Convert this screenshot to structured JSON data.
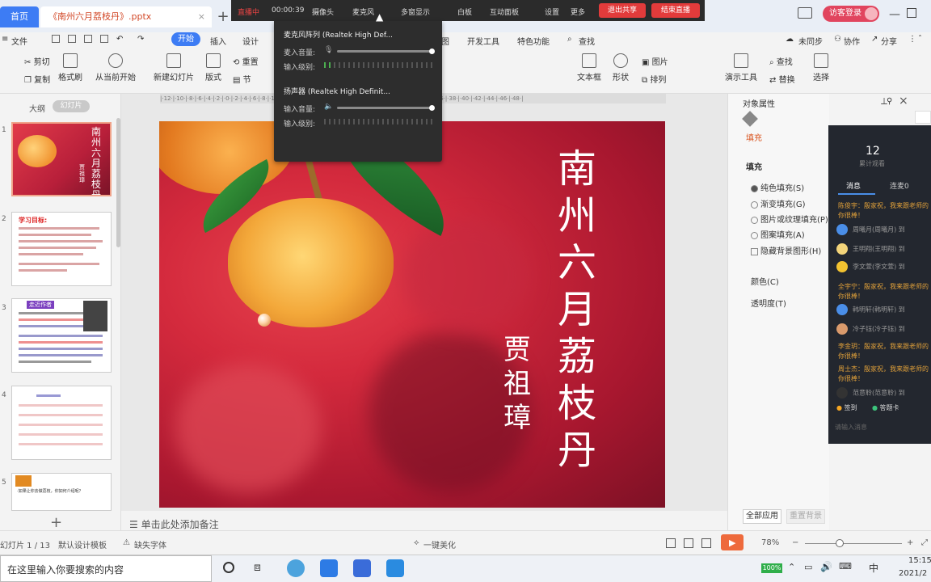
{
  "titlebar": {
    "home_tab": "首页",
    "doc_tab": "《南州六月荔枝丹》.pptx",
    "new_tab": "+",
    "login_label": "访客登录"
  },
  "recording_bar": {
    "status": "直播中",
    "timer": "00:00:39",
    "items": [
      "摄像头",
      "麦克风",
      "多窗显示",
      "白板",
      "互动面板",
      "设置",
      "更多"
    ],
    "stop_label": "退出共享",
    "end_label": "结束直播"
  },
  "popup": {
    "mic_device": "麦克风阵列 (Realtek High Def...",
    "mic_volume_label": "麦入音量:",
    "mic_level_label": "输入级别:",
    "speaker_device": "扬声器 (Realtek High Definit...",
    "speaker_volume_label": "输入音量:",
    "speaker_level_label": "输入级别:"
  },
  "menubar": {
    "file": "文件",
    "start": "开始",
    "insert": "插入",
    "design": "设计",
    "animation": "图",
    "dev": "开发工具",
    "special": "特色功能",
    "search": "查找",
    "cloud": "未同步",
    "collab": "协作",
    "share": "分享"
  },
  "ribbon": {
    "cut": "剪切",
    "copy": "复制",
    "format_painter": "格式刷",
    "from_start": "从当前开始",
    "new_slide": "新建幻灯片",
    "layout": "版式",
    "reset": "重置",
    "section": "节",
    "textbox": "文本框",
    "shape": "形状",
    "arrange": "排列",
    "image": "图片",
    "find": "查找",
    "replace": "替换",
    "present_tools": "演示工具",
    "select": "选择"
  },
  "left_panel": {
    "outline_tab": "大纲",
    "slides_tab": "幻灯片",
    "thumb1_title": "南州六月荔枝丹",
    "thumb1_author": "贾祖璋",
    "thumb2_heading": "学习目标:",
    "thumb3_badge": "走近作者",
    "thumb5_text": "·如果让你去做荔枝，你如何介绍呢？",
    "slide_numbers": [
      "1",
      "2",
      "3",
      "4",
      "5"
    ]
  },
  "slide": {
    "title": "南州六月荔枝丹",
    "author": "贾祖璋"
  },
  "notes": "单击此处添加备注",
  "properties": {
    "header": "对象属性",
    "fill_tab": "填充",
    "fill_section": "填充",
    "options": [
      "纯色填充(S)",
      "渐变填充(G)",
      "图片或纹理填充(P)",
      "图案填充(A)"
    ],
    "hide_bg": "隐藏背景图形(H)",
    "color": "颜色(C)",
    "transparency": "透明度(T)",
    "apply_all": "全部应用",
    "reset_bg": "重置背景"
  },
  "chat": {
    "count": "12",
    "count_label": "累计观看",
    "tab_messages": "消息",
    "tab_online": "连麦0",
    "messages": [
      "陈俊宇：殷家祝，我来跟老师的",
      "你很棒！",
      "全宇宁：殷家祝，我来跟老师的",
      "你很棒！",
      "李金玥：殷家祝，我来跟老师的",
      "你很棒！",
      "周士杰：殷家祝，我来跟老师的",
      "你很棒！"
    ],
    "users": [
      "周曦月(周曦月) 到",
      "王明翔(王明翔) 到",
      "李文萱(李文萱) 到",
      "韩明轩(韩明轩) 到",
      "冷子钰(冷子钰) 到",
      "范意聆(范意聆) 到"
    ],
    "sign_in": "签到",
    "quiz": "答题卡",
    "input_placeholder": "请输入消息"
  },
  "statusbar": {
    "slide_info": "幻灯片 1 / 13",
    "template": "默认设计模板",
    "missing_font": "缺失字体",
    "beautify": "一键美化",
    "zoom": "78%"
  },
  "taskbar": {
    "search_placeholder": "在这里输入你要搜索的内容",
    "battery": "100%",
    "ime": "中",
    "time": "15:15",
    "date": "2021/2"
  }
}
